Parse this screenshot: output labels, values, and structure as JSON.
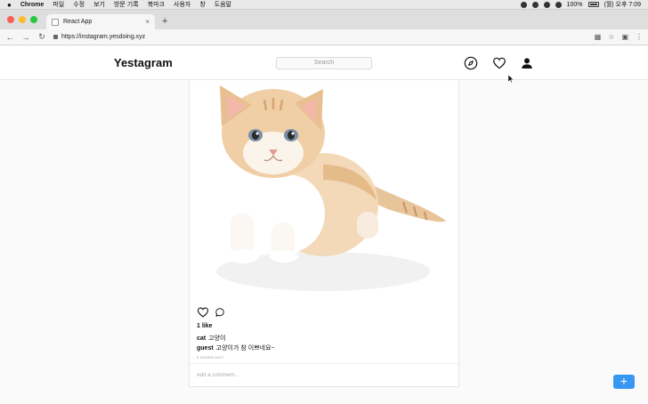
{
  "menubar": {
    "app_name": "Chrome",
    "items": [
      "파일",
      "수정",
      "보기",
      "방문 기록",
      "북마크",
      "사용자",
      "창",
      "도움말"
    ],
    "battery": "100%",
    "clock": "(월) 오후 7:09"
  },
  "browser": {
    "tab_title": "React App",
    "tab_close": "×",
    "new_tab": "+",
    "url": "https://instagram.yesdoing.xyz"
  },
  "app": {
    "logo": "Yestagram",
    "search_placeholder": "Search",
    "icons": [
      "compass-icon",
      "heart-icon",
      "person-icon"
    ]
  },
  "post": {
    "likes_text": "1 like",
    "caption": {
      "user": "cat",
      "text": "고양이"
    },
    "comment": {
      "user": "guest",
      "text": "고양이가 참 이쁘네요~"
    },
    "time_ago": "5 HOURS AGO",
    "add_comment_placeholder": "Add a comment..."
  },
  "fab_label": "+",
  "colors": {
    "accent": "#3897f0",
    "text": "#111111",
    "background": "#fafafa"
  }
}
